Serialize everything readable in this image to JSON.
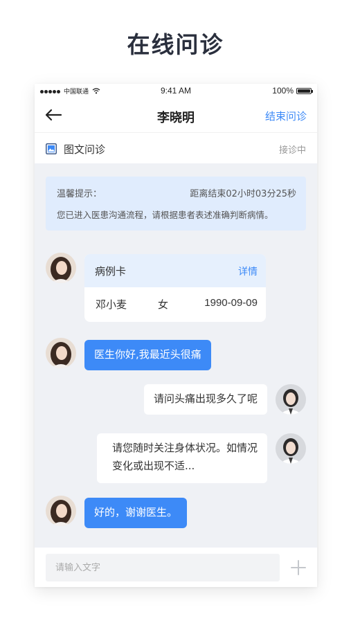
{
  "page_title": "在线问诊",
  "status_bar": {
    "carrier": "中国联通",
    "time": "9:41 AM",
    "battery": "100%"
  },
  "nav": {
    "title": "李晓明",
    "end_button": "结束问诊",
    "back_icon": "back-arrow-icon"
  },
  "sub_bar": {
    "icon": "image-text-icon",
    "label": "图文问诊",
    "status": "接诊中"
  },
  "notice": {
    "title": "温馨提示：",
    "countdown": "距离结束02小时03分25秒",
    "text": "您已进入医患沟通流程，请根据患者表述准确判断病情。"
  },
  "case_card": {
    "title": "病例卡",
    "detail_link": "详情",
    "name": "邓小麦",
    "gender": "女",
    "dob": "1990-09-09"
  },
  "messages": [
    {
      "from": "patient",
      "text": "医生你好,我最近头很痛"
    },
    {
      "from": "doctor",
      "text": "请问头痛出现多久了呢"
    },
    {
      "from": "doctor",
      "lines": [
        "请您随时关注身体状况。如情况",
        "变化或出现不适..."
      ]
    },
    {
      "from": "patient",
      "text": "好的，谢谢医生。"
    }
  ],
  "input": {
    "placeholder": "请输入文字"
  },
  "colors": {
    "accent": "#3d8af7",
    "notice_bg": "#e0ecfd",
    "chat_bg": "#eff1f5"
  }
}
